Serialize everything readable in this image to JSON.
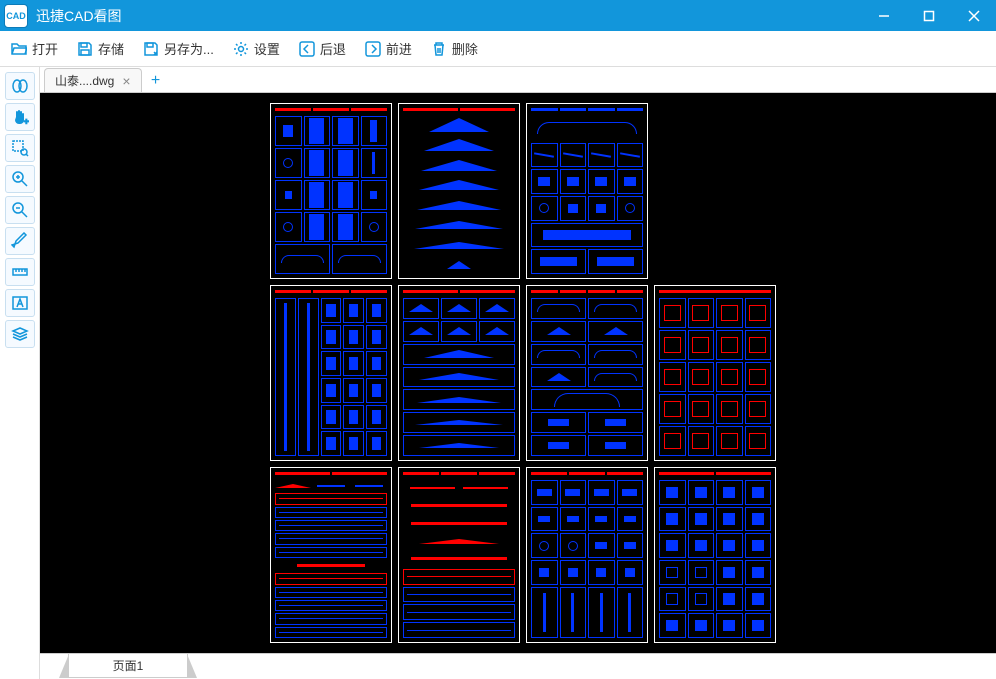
{
  "titlebar": {
    "appName": "迅捷CAD看图",
    "logoText": "CAD"
  },
  "toolbar": {
    "open": "打开",
    "save": "存储",
    "saveAs": "另存为...",
    "settings": "设置",
    "back": "后退",
    "forward": "前进",
    "delete": "删除"
  },
  "tabs": {
    "file1": "山泰....dwg"
  },
  "bottomTabs": {
    "page1": "页面1"
  }
}
